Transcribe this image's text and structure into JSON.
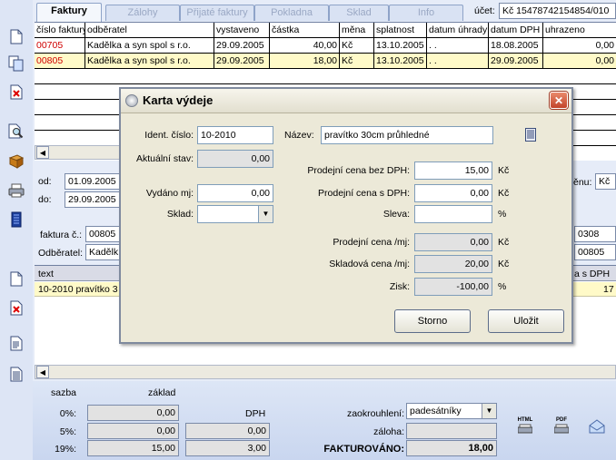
{
  "tabs": [
    "Faktury",
    "Zálohy",
    "Přijaté faktury",
    "Pokladna",
    "Sklad",
    "Info"
  ],
  "account": {
    "label": "účet:",
    "value": "Kč  15478742154854/010"
  },
  "table": {
    "headers": [
      "číslo faktury",
      "odběratel",
      "vystaveno",
      "částka",
      "měna",
      "splatnost",
      "datum úhrady",
      "datum DPH",
      "uhrazeno"
    ],
    "rows": [
      [
        "00705",
        "Kadělka a syn spol s r.o.",
        "29.09.2005",
        "40,00",
        "Kč",
        "13.10.2005",
        ". .",
        "18.08.2005",
        "0,00"
      ],
      [
        "00805",
        "Kadělka a syn spol s r.o.",
        "29.09.2005",
        "18,00",
        "Kč",
        "13.10.2005",
        ". .",
        "29.09.2005",
        "0,00"
      ]
    ]
  },
  "filter": {
    "od_label": "od:",
    "od_value": "01.09.2005",
    "do_label": "do:",
    "do_value": "29.09.2005",
    "menu_label": "ěnu:",
    "menu_value": "Kč"
  },
  "invoice": {
    "faktura_label": "faktura č.:",
    "faktura_value": "00805",
    "odberatel_label": "Odběratel:",
    "odberatel_value": "Kadělk",
    "right1": "0308",
    "right2": "00805"
  },
  "items": {
    "col_text": "text",
    "col_right": "a s DPH",
    "row_text": "10-2010 pravítko 3",
    "row_right": "17"
  },
  "summary": {
    "sazba": "sazba",
    "zaklad": "základ",
    "dph": "DPH",
    "rates": [
      "0%:",
      "5%:",
      "19%:"
    ],
    "base": [
      "0,00",
      "0,00",
      "15,00"
    ],
    "vat": [
      "0,00",
      "3,00"
    ],
    "zaokrouhleni_label": "zaokrouhlení:",
    "zaokrouhleni_value": "padesátníky",
    "zaloha_label": "záloha:",
    "fakturovano_label": "FAKTUROVÁNO:",
    "fakturovano_value": "18,00",
    "html_label": "HTML",
    "pdf_label": "PDF"
  },
  "dialog": {
    "title": "Karta výdeje",
    "ident_label": "Ident. číslo:",
    "ident_value": "10-2010",
    "nazev_label": "Název:",
    "nazev_value": "pravítko 30cm průhledné",
    "aktualni_label": "Aktuální stav:",
    "aktualni_value": "0,00",
    "vydano_label": "Vydáno mj:",
    "vydano_value": "0,00",
    "sklad_label": "Sklad:",
    "sklad_value": "",
    "pcbez_label": "Prodejní cena bez DPH:",
    "pcbez_value": "15,00",
    "pcs_label": "Prodejní cena s DPH:",
    "pcs_value": "0,00",
    "sleva_label": "Sleva:",
    "sleva_value": "",
    "pcmj_label": "Prodejní cena /mj:",
    "pcmj_value": "0,00",
    "skl_label": "Skladová cena /mj:",
    "skl_value": "20,00",
    "zisk_label": "Zisk:",
    "zisk_value": "-100,00",
    "kc": "Kč",
    "pct": "%",
    "storno": "Storno",
    "ulozit": "Uložit"
  }
}
